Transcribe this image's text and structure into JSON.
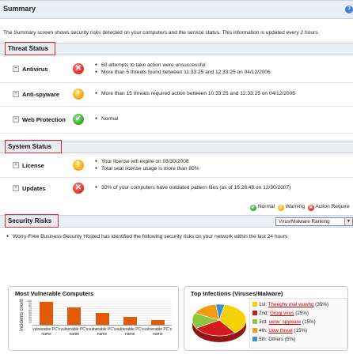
{
  "header": {
    "title": "Summary",
    "help_icon": "help-icon"
  },
  "intro": "The Summary screen shows security risks detected on your computers and the service status. This information is updated every 2 hours.",
  "threat_status": {
    "title": "Threat Status",
    "rows": [
      {
        "label": "Antivirus",
        "status": "critical",
        "lines": [
          "60 attempts to take action were unsuccessful",
          "More than 5 threats found between 11:33:25 and 12:33:25 on 04/12/2006"
        ]
      },
      {
        "label": "Anti-spyware",
        "status": "warning",
        "lines": [
          "More than 15 threats required action between 10:33:25 and 12:33:25 on 04/12/2006"
        ]
      },
      {
        "label": "Web Protection",
        "status": "normal",
        "lines": [
          "Normal"
        ]
      }
    ]
  },
  "system_status": {
    "title": "System Status",
    "rows": [
      {
        "label": "License",
        "status": "warning",
        "lines": [
          "Your license will expire on 03/30/2008",
          "Total seat license usage is more than 80%"
        ]
      },
      {
        "label": "Updates",
        "status": "critical",
        "lines": [
          "30% of your computers have outdated pattern files (as of 16:28:48 on 12/30/2007)"
        ]
      }
    ]
  },
  "legend": {
    "normal": "Normal",
    "warning": "Warning",
    "action": "Action Require"
  },
  "security_risks": {
    "title": "Security Risks",
    "ranking_select": "Virus/Malware Ranking",
    "description": "Worry-Free Business Security Hosted has identified the following security risks on your network within the last 24 hours"
  },
  "vulnerable_panel": {
    "title": "Most Vulnerable Computers"
  },
  "infections_panel": {
    "title": "Top Infections (Viruses/Malware)",
    "items": [
      {
        "rank": "1st:",
        "name": "Theeghv mal wuwhg",
        "pct": "(35%)",
        "color": "#f5d10a",
        "link": true
      },
      {
        "rank": "2nd:",
        "name": "Grogj virus",
        "pct": "(25%)",
        "color": "#d01c1c",
        "link": true
      },
      {
        "rank": "3rd:",
        "name": "uerw: spyware",
        "pct": "(15%)",
        "color": "#8cc63e",
        "link": true
      },
      {
        "rank": "4th:",
        "name": "Uew threat",
        "pct": "(15%)",
        "color": "#f39c12",
        "link": true
      },
      {
        "rank": "5th:",
        "name": "Others",
        "pct": "(5%)",
        "color": "#3a8fd8",
        "link": false
      }
    ]
  },
  "chart_data": {
    "type": "bar",
    "title": "Most Vulnerable Computers",
    "ylabel": "Incidents count",
    "categories": [
      "vulnerable PC's name",
      "vulnerable PC's name",
      "vulnerable PC's name",
      "vulnerable PC's name",
      "vulnerable PC's name"
    ],
    "values": [
      97,
      73,
      50,
      33,
      19
    ],
    "ylim": [
      0,
      100
    ],
    "yticks": [
      "100",
      "90",
      "80",
      "70",
      "60",
      "50",
      "40",
      "30",
      "20",
      "10"
    ],
    "bar_color": "#e05a0a",
    "grid": true
  },
  "pie_data": {
    "type": "pie",
    "title": "Top Infections (Viruses/Malware)",
    "values": [
      35,
      25,
      15,
      15,
      5
    ],
    "colors": [
      "#f5d10a",
      "#d01c1c",
      "#8cc63e",
      "#f39c12",
      "#3a8fd8"
    ]
  }
}
